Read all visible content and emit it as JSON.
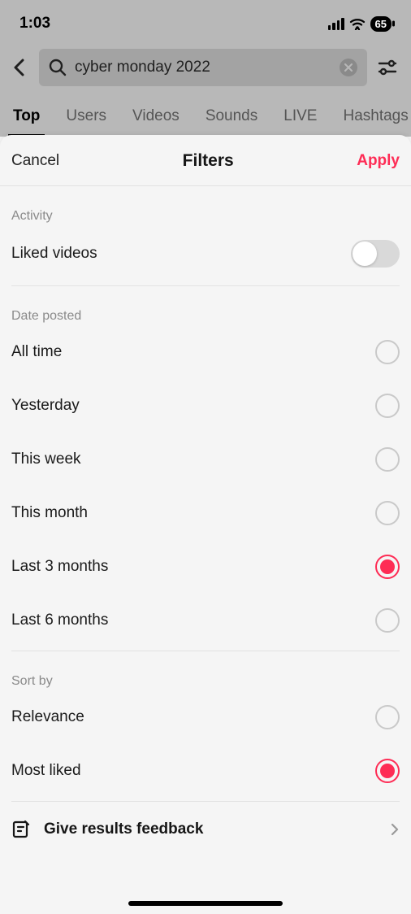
{
  "status": {
    "time": "1:03",
    "battery": "65"
  },
  "search": {
    "query": "cyber monday 2022"
  },
  "tabs": {
    "items": [
      {
        "label": "Top",
        "active": true
      },
      {
        "label": "Users",
        "active": false
      },
      {
        "label": "Videos",
        "active": false
      },
      {
        "label": "Sounds",
        "active": false
      },
      {
        "label": "LIVE",
        "active": false
      },
      {
        "label": "Hashtags",
        "active": false
      }
    ]
  },
  "sheet": {
    "cancel": "Cancel",
    "title": "Filters",
    "apply": "Apply"
  },
  "activity": {
    "section_label": "Activity",
    "liked_videos_label": "Liked videos",
    "liked_videos_on": false
  },
  "date_posted": {
    "section_label": "Date posted",
    "options": [
      {
        "label": "All time",
        "selected": false
      },
      {
        "label": "Yesterday",
        "selected": false
      },
      {
        "label": "This week",
        "selected": false
      },
      {
        "label": "This month",
        "selected": false
      },
      {
        "label": "Last 3 months",
        "selected": true
      },
      {
        "label": "Last 6 months",
        "selected": false
      }
    ]
  },
  "sort_by": {
    "section_label": "Sort by",
    "options": [
      {
        "label": "Relevance",
        "selected": false
      },
      {
        "label": "Most liked",
        "selected": true
      }
    ]
  },
  "feedback": {
    "label": "Give results feedback"
  },
  "colors": {
    "accent": "#fe2c55"
  }
}
